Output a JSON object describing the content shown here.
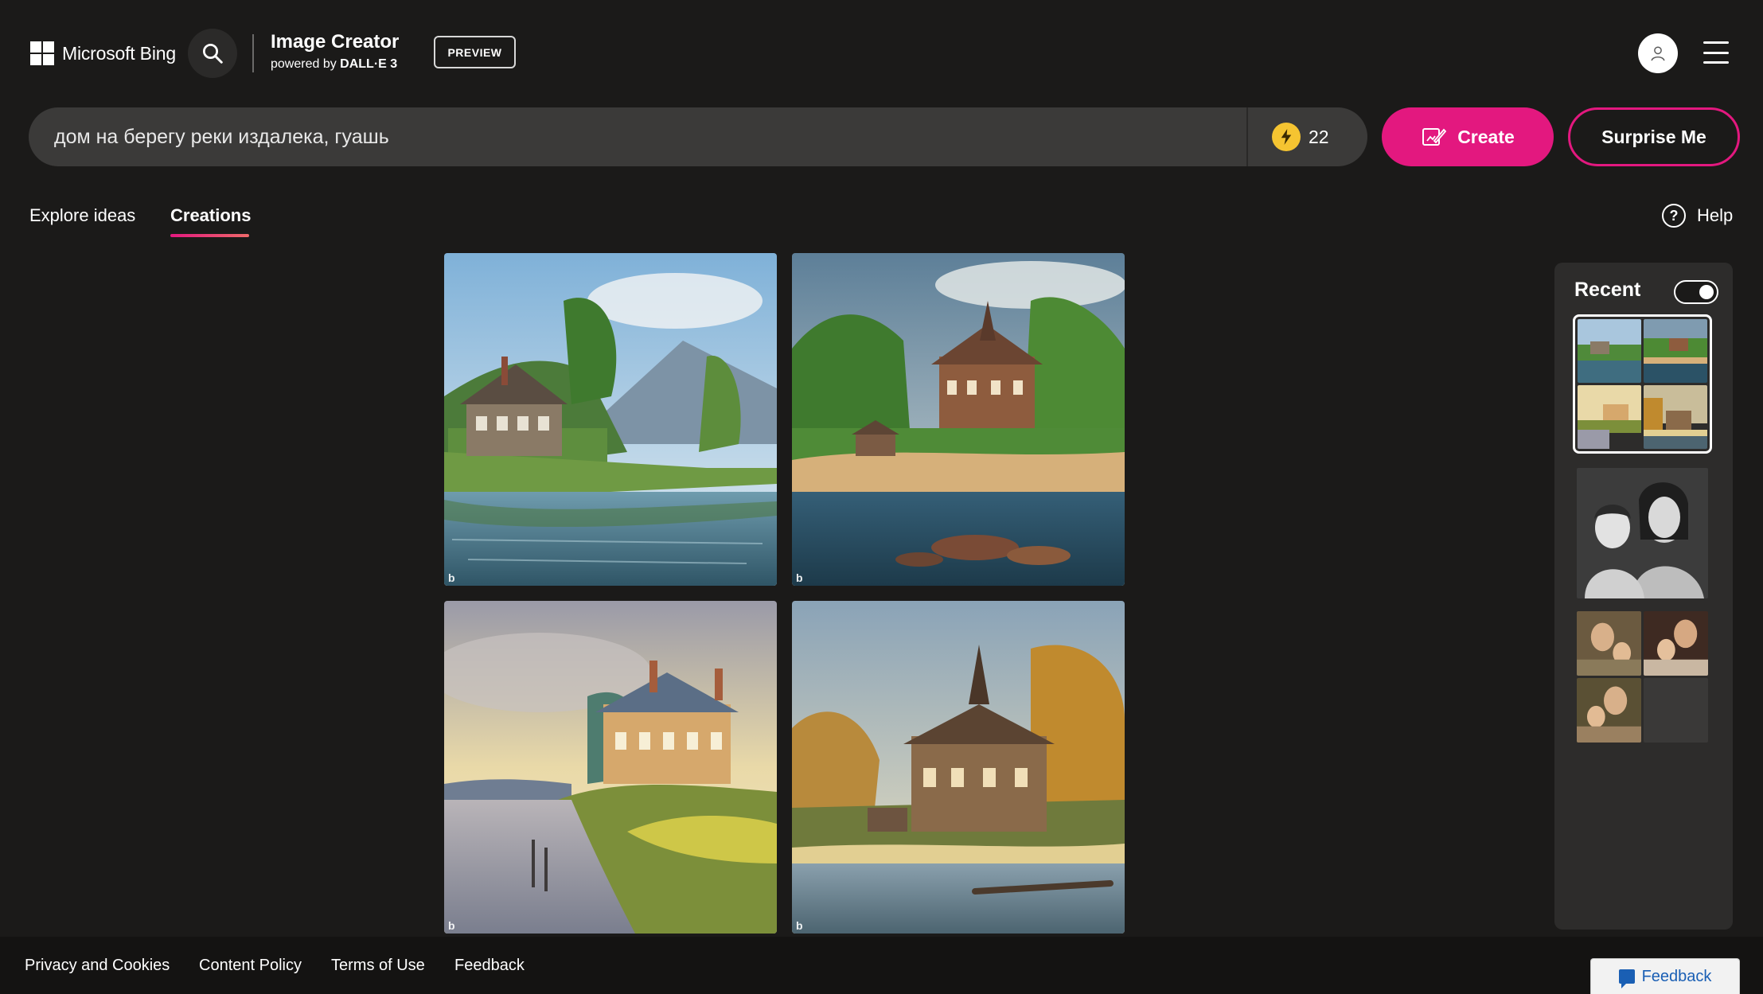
{
  "header": {
    "brand": "Microsoft Bing",
    "product_title": "Image Creator",
    "product_sub_prefix": "powered by ",
    "product_sub_model": "DALL·E 3",
    "preview_badge": "PREVIEW"
  },
  "prompt": {
    "value": "дом на берегу реки издалека, гуашь",
    "boosts": "22",
    "create_label": "Create",
    "surprise_label": "Surprise Me"
  },
  "tabs": {
    "explore": "Explore ideas",
    "creations": "Creations",
    "active": "Creations"
  },
  "help_label": "Help",
  "images": [
    {
      "name": "River house gouache 1",
      "mark": "b"
    },
    {
      "name": "River house gouache 2",
      "mark": "b"
    },
    {
      "name": "River house gouache 3",
      "mark": "b"
    },
    {
      "name": "River house gouache 4",
      "mark": "b"
    }
  ],
  "recent": {
    "title": "Recent",
    "toggle_on": true
  },
  "footer": {
    "links": [
      "Privacy and Cookies",
      "Content Policy",
      "Terms of Use",
      "Feedback"
    ],
    "feedback_button": "Feedback"
  },
  "colors": {
    "background": "#1b1a19",
    "accent": "#e3187f",
    "prompt_bar": "#3b3a39",
    "boost_coin": "#f5c431",
    "panel": "#2d2c2b"
  },
  "icons": [
    "windows-logo-icon",
    "search-icon",
    "user-icon",
    "hamburger-menu-icon",
    "lightning-bolt-icon",
    "create-brush-icon",
    "help-icon",
    "feedback-chat-icon"
  ]
}
